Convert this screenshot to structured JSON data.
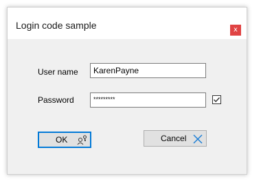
{
  "window": {
    "title": "Login code sample",
    "close_glyph": "x"
  },
  "form": {
    "username_label": "User name",
    "username_value": "KarenPayne",
    "password_label": "Password",
    "password_value": "*********",
    "show_password_checked": true
  },
  "buttons": {
    "ok_label": "OK",
    "ok_icon": "users-key-icon",
    "cancel_label": "Cancel",
    "cancel_icon": "x-cross-icon"
  },
  "colors": {
    "close_button": "#e04343",
    "cancel_icon": "#1e7fd6",
    "ok_border": "#0078d7"
  }
}
